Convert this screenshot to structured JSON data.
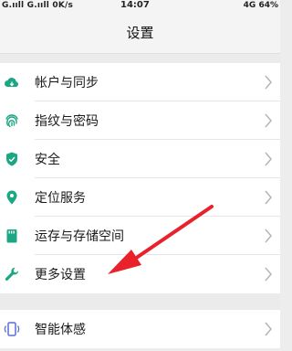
{
  "status_bar": {
    "left": "G.ııll G.ııll 0K/s",
    "time": "14:07",
    "right": "4G 64%"
  },
  "header": {
    "title": "设置"
  },
  "settings_items": [
    {
      "label": "帐户与同步",
      "icon": "cloud-icon"
    },
    {
      "label": "指纹与密码",
      "icon": "fingerprint-icon"
    },
    {
      "label": "安全",
      "icon": "shield-icon"
    },
    {
      "label": "定位服务",
      "icon": "location-pin-icon"
    },
    {
      "label": "运存与存储空间",
      "icon": "storage-card-icon"
    },
    {
      "label": "更多设置",
      "icon": "wrench-icon"
    }
  ],
  "settings_items_2": [
    {
      "label": "智能体感",
      "icon": "phone-gesture-icon"
    }
  ],
  "colors": {
    "accent": "#1ba784",
    "arrow": "#e8212a",
    "chevron": "#b5b5b5"
  }
}
